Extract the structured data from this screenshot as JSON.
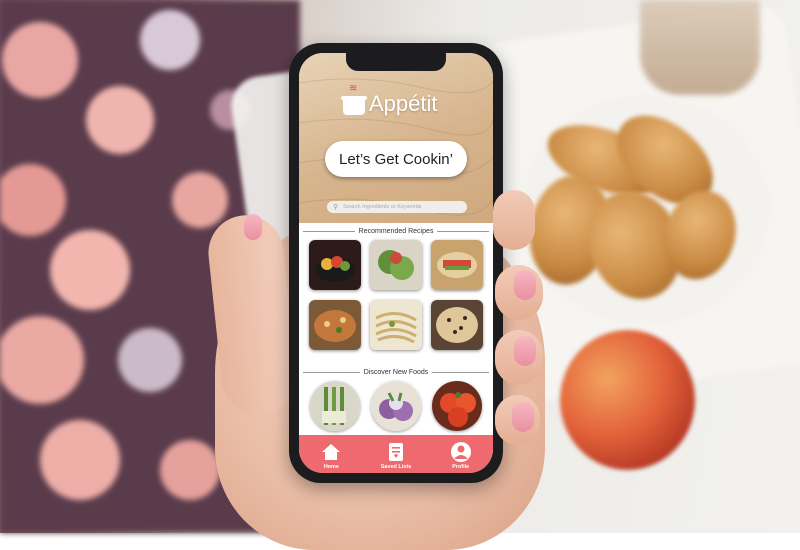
{
  "app": {
    "brand": "Appétit",
    "cta_label": "Let’s Get Cookin’",
    "search_placeholder": "Search Ingredients or Keywords",
    "sections": {
      "recommended": "Recommended Recipes",
      "discover": "Discover New Foods"
    },
    "recipes": [
      {
        "icon": "salad-bowl-icon"
      },
      {
        "icon": "green-salad-icon"
      },
      {
        "icon": "wrap-icon"
      },
      {
        "icon": "soup-icon"
      },
      {
        "icon": "noodles-icon"
      },
      {
        "icon": "pasta-icon"
      }
    ],
    "foods": [
      {
        "icon": "leek-icon"
      },
      {
        "icon": "turnip-icon"
      },
      {
        "icon": "tomato-icon"
      }
    ],
    "nav": [
      {
        "label": "Home",
        "icon": "home-icon"
      },
      {
        "label": "Saved Lists",
        "icon": "saved-lists-icon"
      },
      {
        "label": "Profile",
        "icon": "profile-icon"
      }
    ]
  },
  "colors": {
    "accent": "#ee6a6e",
    "wood": "#d6b48d",
    "steam": "#d84b3a"
  }
}
